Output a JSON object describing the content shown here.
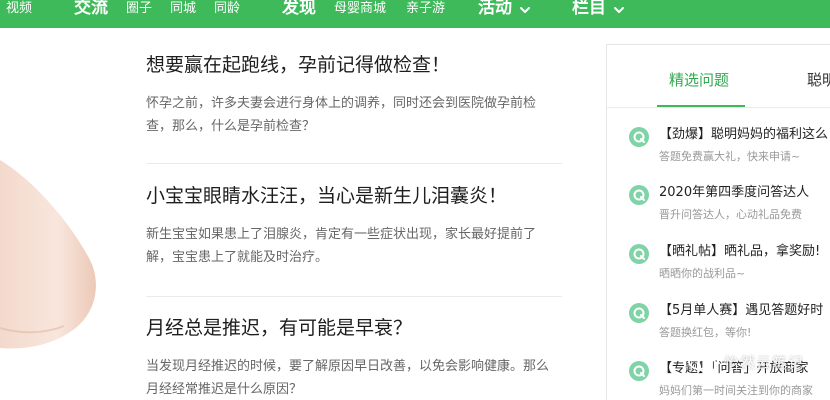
{
  "nav": {
    "items": [
      {
        "label": "视频"
      },
      {
        "label": "交流"
      },
      {
        "label": "圈子"
      },
      {
        "label": "同城"
      },
      {
        "label": "同龄"
      },
      {
        "label": "发现"
      },
      {
        "label": "母婴商城"
      },
      {
        "label": "亲子游"
      },
      {
        "label": "活动"
      },
      {
        "label": "栏目"
      }
    ],
    "chevron_icon": "chevron-down-icon",
    "bg_color": "#3fba5b"
  },
  "articles": [
    {
      "title": "想要赢在起跑线，孕前记得做检查！",
      "summary": "怀孕之前，许多夫妻会进行身体上的调养，同时还会到医院做孕前检查，那么，什么是孕前检查？"
    },
    {
      "title": "小宝宝眼睛水汪汪，当心是新生儿泪囊炎！",
      "summary": "新生宝宝如果患上了泪腺炎，肯定有一些症状出现，家长最好提前了解，宝宝患上了就能及时治疗。"
    },
    {
      "title": "月经总是推迟，有可能是早衰？",
      "summary": "当发现月经推迟的时候，要了解原因早日改善，以免会影响健康。那么月经经常推迟是什么原因？"
    }
  ],
  "sidebar": {
    "tabs": [
      {
        "label": "精选问题",
        "active": true
      },
      {
        "label": "聪明"
      }
    ],
    "icon": "q-badge-icon",
    "accent_color": "#2fa84f",
    "items": [
      {
        "title": "【劲爆】聪明妈妈的福利这么",
        "subtitle": "答题免费赢大礼，快来申请~"
      },
      {
        "title": "2020年第四季度问答达人",
        "subtitle": "晋升问答达人，心动礼品免费"
      },
      {
        "title": "【晒礼帖】晒礼品，拿奖励!",
        "subtitle": "晒晒你的战利品~"
      },
      {
        "title": "【5月单人赛】遇见答题好时",
        "subtitle": "答题换红包，等你!"
      },
      {
        "title": "【专题】「问答」开放商家",
        "subtitle": "妈妈们第一时间关注到你的商家"
      }
    ]
  },
  "watermark": {
    "text": "怡然云笔记",
    "icon": "wechat-icon"
  }
}
